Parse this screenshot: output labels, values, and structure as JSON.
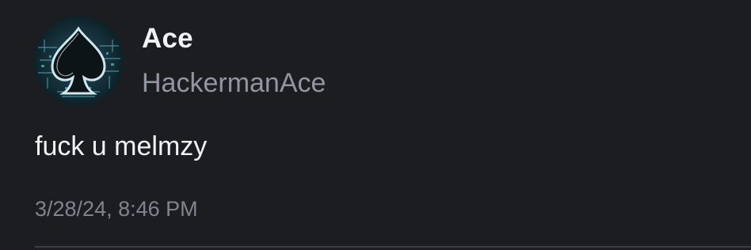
{
  "user": {
    "display_name": "Ace",
    "username": "HackermanAce",
    "avatar_icon": "spade-avatar-icon"
  },
  "message": {
    "text": "fuck u melmzy",
    "timestamp": "3/28/24, 8:46 PM"
  },
  "colors": {
    "background": "#1c1d21",
    "primary_text": "#f2f3f5",
    "secondary_text": "#9196a0",
    "timestamp_text": "#80848e"
  }
}
